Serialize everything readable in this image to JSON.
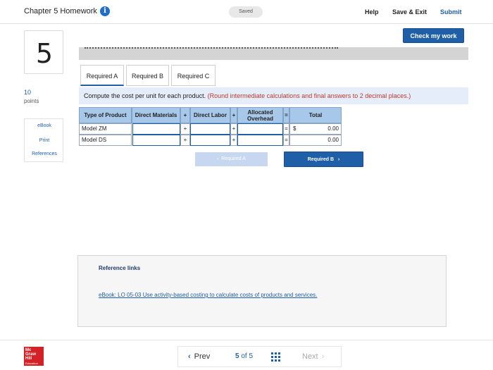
{
  "header": {
    "title": "Chapter 5 Homework",
    "info_icon": "info-icon",
    "saved": "Saved",
    "help": "Help",
    "save_exit": "Save & Exit",
    "submit": "Submit"
  },
  "question": {
    "number": "5",
    "points_value": "10",
    "points_label": "points",
    "check_button": "Check my work"
  },
  "side_links": [
    "eBook",
    "Print",
    "References"
  ],
  "tabs": [
    {
      "label": "Required A",
      "active": true
    },
    {
      "label": "Required B",
      "active": false
    },
    {
      "label": "Required C",
      "active": false
    }
  ],
  "instruction": {
    "text": "Compute the cost per unit for each product.",
    "note": "(Round intermediate calculations and final answers to 2 decimal places.)"
  },
  "table": {
    "headers": {
      "type": "Type of Product",
      "direct_materials": "Direct Materials",
      "direct_labor": "Direct Labor",
      "overhead": "Allocated Overhead",
      "total": "Total"
    },
    "operators": {
      "plus": "+",
      "equals": "="
    },
    "currency": "$",
    "rows": [
      {
        "label": "Model ZM",
        "direct_materials": "",
        "direct_labor": "",
        "overhead": "",
        "total": "0.00"
      },
      {
        "label": "Model DS",
        "direct_materials": "",
        "direct_labor": "",
        "overhead": "",
        "total": "0.00"
      }
    ]
  },
  "nav_buttons": {
    "prev_label": "Required A",
    "next_label": "Required B"
  },
  "reference": {
    "title": "Reference links",
    "link": "eBook: LO 05-03 Use activity-based costing to calculate costs of products and services."
  },
  "footer": {
    "logo_lines": [
      "Mc",
      "Graw",
      "Hill"
    ],
    "logo_sub": "Education",
    "prev": "Prev",
    "current_page": "5",
    "of": "of",
    "total_pages": "5",
    "next": "Next"
  },
  "colors": {
    "accent": "#1f5fa8",
    "header_cell": "#a8c8ea",
    "instruction_bg": "#e4edf9",
    "note_red": "#c0392b",
    "logo_red": "#d42027"
  }
}
